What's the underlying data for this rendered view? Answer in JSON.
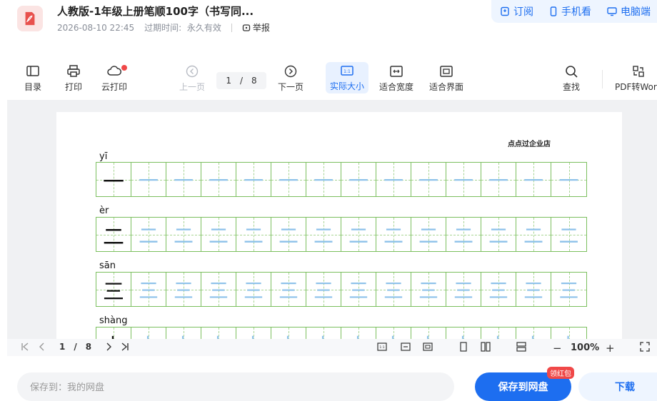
{
  "header": {
    "title": "人教版-1年级上册笔顺100字（书写同...",
    "date": "2026-08-10 22:45",
    "expiry_label": "过期时间:",
    "expiry_value": "永久有效",
    "report": "举报",
    "actions": [
      {
        "label": "订阅",
        "icon": "subscribe-icon"
      },
      {
        "label": "手机看",
        "icon": "phone-icon"
      },
      {
        "label": "电脑端",
        "icon": "monitor-icon"
      }
    ]
  },
  "toolbar": {
    "toc": "目录",
    "print": "打印",
    "cloud_print": "云打印",
    "prev": "上一页",
    "page_current": "1",
    "page_sep": "/",
    "page_total": "8",
    "next": "下一页",
    "actual_size": "实际大小",
    "fit_width": "适合宽度",
    "fit_page": "适合界面",
    "find": "查找",
    "pdf_to_word": "PDF转Word"
  },
  "document": {
    "shop_name": "点点过企业店",
    "rows": [
      {
        "pinyin": "yī",
        "char": "一"
      },
      {
        "pinyin": "èr",
        "char": "二"
      },
      {
        "pinyin": "sān",
        "char": "三"
      },
      {
        "pinyin": "shàng",
        "char": "上"
      }
    ]
  },
  "bottombar": {
    "page_current": "1",
    "page_sep": "/",
    "page_total": "8",
    "zoom": "100%",
    "zoom_minus": "−",
    "zoom_plus": "+"
  },
  "footer": {
    "save_placeholder": "保存到：我的网盘",
    "save_button": "保存到网盘",
    "red_badge": "领红包",
    "download_button": "下载"
  }
}
